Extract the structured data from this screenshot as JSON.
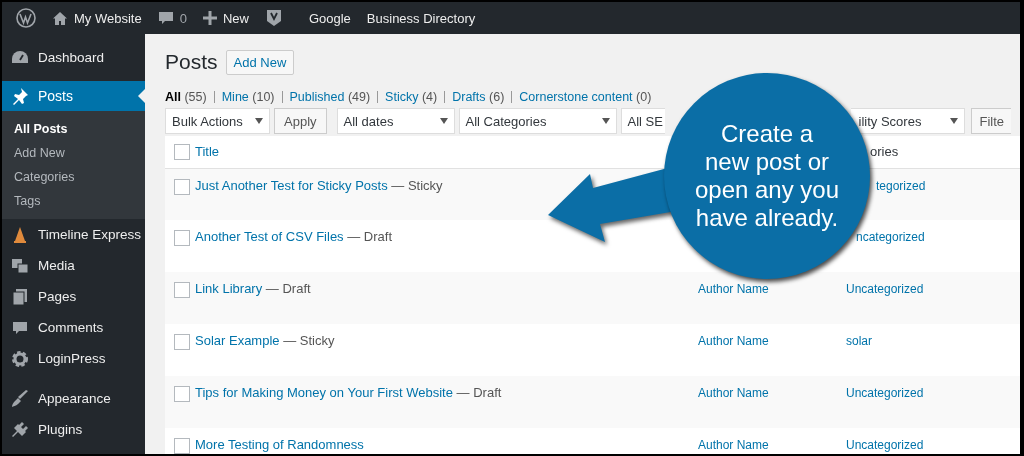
{
  "admin_bar": {
    "items": [
      {
        "kind": "home",
        "label": "My Website"
      },
      {
        "kind": "comments",
        "label": "0"
      },
      {
        "kind": "new",
        "label": "New"
      },
      {
        "kind": "seo"
      },
      {
        "kind": "text",
        "label": "Google"
      },
      {
        "kind": "text",
        "label": "Business Directory"
      }
    ]
  },
  "sidebar": {
    "items": [
      {
        "kind": "dashboard",
        "label": "Dashboard",
        "selected": false
      },
      {
        "kind": "posts",
        "label": "Posts",
        "selected": true,
        "children": [
          {
            "label": "All Posts",
            "selected": true
          },
          {
            "label": "Add New",
            "selected": false
          },
          {
            "label": "Categories",
            "selected": false
          },
          {
            "label": "Tags",
            "selected": false
          }
        ]
      },
      {
        "kind": "timeline",
        "label": "Timeline Express",
        "selected": false
      },
      {
        "kind": "media",
        "label": "Media",
        "selected": false
      },
      {
        "kind": "pages",
        "label": "Pages",
        "selected": false
      },
      {
        "kind": "comments",
        "label": "Comments",
        "selected": false
      },
      {
        "kind": "settings",
        "label": "LoginPress",
        "selected": false
      },
      {
        "kind": "separator"
      },
      {
        "kind": "appearance",
        "label": "Appearance",
        "selected": false
      },
      {
        "kind": "plugins",
        "label": "Plugins",
        "selected": false
      }
    ]
  },
  "content": {
    "title": "Posts",
    "add_new": "Add New",
    "status_links": [
      {
        "label": "All",
        "count": "(55)",
        "selected": true
      },
      {
        "label": "Mine",
        "count": "(10)",
        "selected": false
      },
      {
        "label": "Published",
        "count": "(49)",
        "selected": false
      },
      {
        "label": "Sticky",
        "count": "(4)",
        "selected": false
      },
      {
        "label": "Drafts",
        "count": "(6)",
        "selected": false
      },
      {
        "label": "Cornerstone content",
        "count": "(0)",
        "selected": false
      }
    ],
    "toolbar": [
      {
        "kind": "select",
        "value": "Bulk Actions"
      },
      {
        "kind": "button",
        "label": "Apply"
      },
      {
        "kind": "select",
        "value": "All dates"
      },
      {
        "kind": "select",
        "value": "All Categories"
      },
      {
        "kind": "select",
        "value": "All SE"
      },
      {
        "kind": "select",
        "value": "ility Scores"
      },
      {
        "kind": "button",
        "label": "Filte"
      }
    ],
    "table": {
      "header": {
        "checked": false,
        "title": "Title",
        "column_3": "ories"
      },
      "rows": [
        {
          "checked": false,
          "title": "Just Another Test for Sticky Posts",
          "state": "— Sticky",
          "category": "tegorized"
        },
        {
          "checked": false,
          "title": "Another Test of CSV Files",
          "state": "— Draft",
          "category": "ncategorized"
        },
        {
          "checked": false,
          "title": "Link Library",
          "state": "— Draft",
          "author": "Author Name",
          "category": "Uncategorized"
        },
        {
          "checked": false,
          "title": "Solar Example",
          "state": "— Sticky",
          "author": "Author Name",
          "category": "solar"
        },
        {
          "checked": false,
          "title": "Tips for Making Money on Your First Website",
          "state": "— Draft",
          "author": "Author Name",
          "category": "Uncategorized"
        },
        {
          "checked": false,
          "title": "More Testing of Randomness",
          "author": "Author Name",
          "category": "Uncategorized"
        }
      ]
    }
  },
  "callout": {
    "lines": [
      "Create a",
      "new post or",
      "open any you",
      "have already."
    ]
  }
}
